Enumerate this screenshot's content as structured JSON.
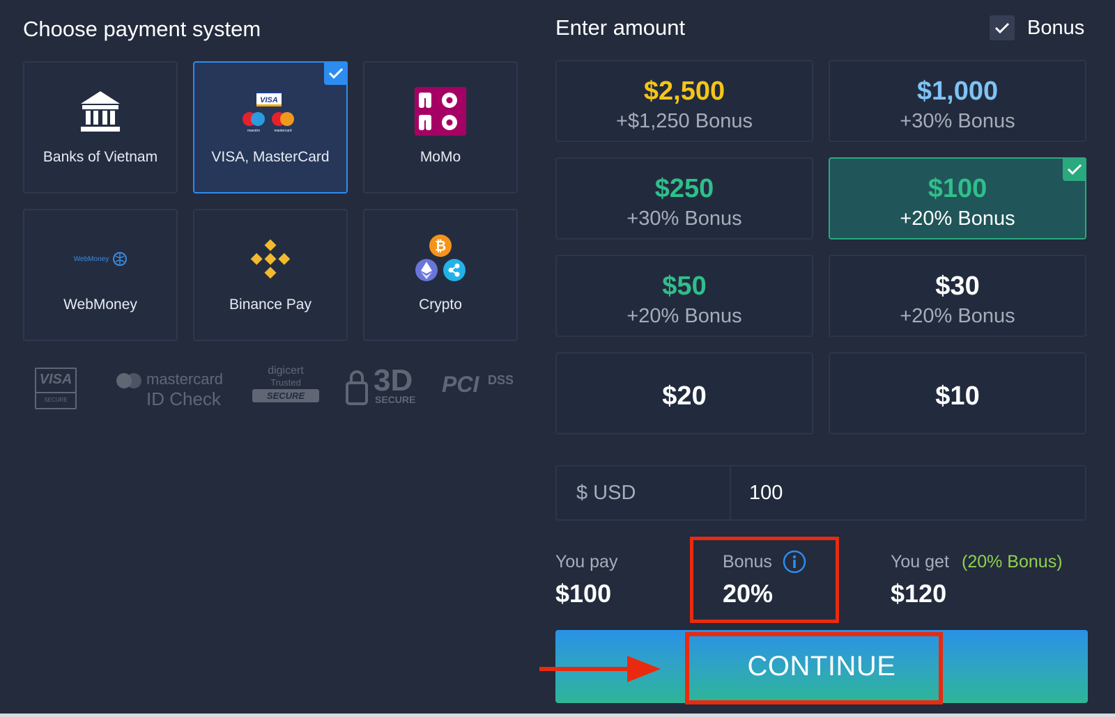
{
  "payment": {
    "title": "Choose payment system",
    "methods": [
      {
        "label": "Banks of Vietnam",
        "icon": "bank-icon"
      },
      {
        "label": "VISA, MasterCard",
        "icon": "visa-mastercard-icon",
        "selected": true
      },
      {
        "label": "MoMo",
        "icon": "momo-logo-icon",
        "logo_text": "mo mo"
      },
      {
        "label": "WebMoney",
        "icon": "webmoney-logo-icon",
        "logo_text": "WebMoney"
      },
      {
        "label": "Binance Pay",
        "icon": "binance-icon"
      },
      {
        "label": "Crypto",
        "icon": "crypto-icon"
      }
    ],
    "security_badges": [
      {
        "name": "visa-secure-icon",
        "text": "VISA",
        "subtext": "SECURE"
      },
      {
        "name": "mastercard-id-check-icon",
        "text": "mastercard",
        "subtext": "ID Check"
      },
      {
        "name": "digicert-icon",
        "text": "digicert",
        "subtext": "Trusted",
        "badge": "SECURE"
      },
      {
        "name": "3d-secure-icon",
        "text": "3D",
        "subtext": "SECURE"
      },
      {
        "name": "pci-dss-icon",
        "text": "PCI",
        "subtext": "DSS"
      }
    ]
  },
  "amount": {
    "title": "Enter amount",
    "bonus_toggle_label": "Bonus",
    "bonus_checked": true,
    "options": [
      {
        "value": "$2,500",
        "bonus": "+$1,250 Bonus",
        "color": "#f5c518"
      },
      {
        "value": "$1,000",
        "bonus": "+30% Bonus",
        "color": "#7ec3f5"
      },
      {
        "value": "$250",
        "bonus": "+30% Bonus",
        "color": "#2fbf8a"
      },
      {
        "value": "$100",
        "bonus": "+20% Bonus",
        "color": "#2fbf8a",
        "selected": true
      },
      {
        "value": "$50",
        "bonus": "+20% Bonus",
        "color": "#2fbf8a"
      },
      {
        "value": "$30",
        "bonus": "+20% Bonus",
        "color": "#ffffff"
      },
      {
        "value": "$20",
        "bonus": "",
        "color": "#ffffff"
      },
      {
        "value": "$10",
        "bonus": "",
        "color": "#ffffff"
      }
    ],
    "currency_label": "$ USD",
    "input_value": "100"
  },
  "summary": {
    "you_pay_label": "You pay",
    "you_pay_value": "$100",
    "bonus_label": "Bonus",
    "bonus_value": "20%",
    "you_get_label": "You get",
    "you_get_note": "(20% Bonus)",
    "you_get_value": "$120"
  },
  "continue_label": "CONTINUE",
  "colors": {
    "background": "#232b3d",
    "accent_blue": "#2d8cf0",
    "accent_green": "#2aa97e",
    "highlight_red": "#ea2a0e"
  }
}
